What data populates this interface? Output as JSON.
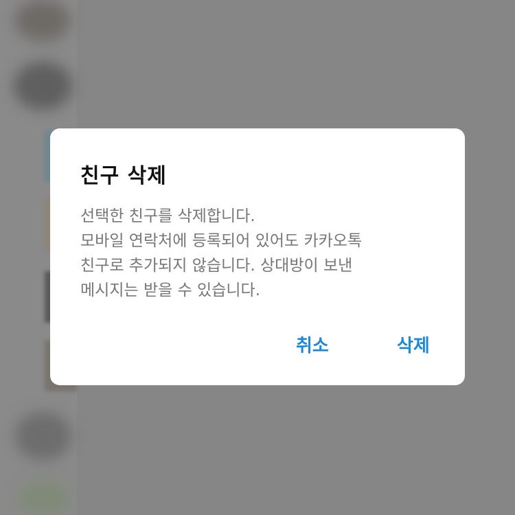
{
  "dialog": {
    "title": "친구 삭제",
    "message": "선택한 친구를 삭제합니다.\n모바일 연락처에 등록되어 있어도 카카오톡\n친구로 추가되지 않습니다. 상대방이 보낸\n메시지는 받을 수 있습니다.",
    "cancel_label": "취소",
    "delete_label": "삭제"
  },
  "colors": {
    "overlay": "#868686",
    "dialog_background": "#ffffff",
    "title_text": "#111111",
    "message_text": "#777777",
    "button_text": "#1e88d8"
  }
}
